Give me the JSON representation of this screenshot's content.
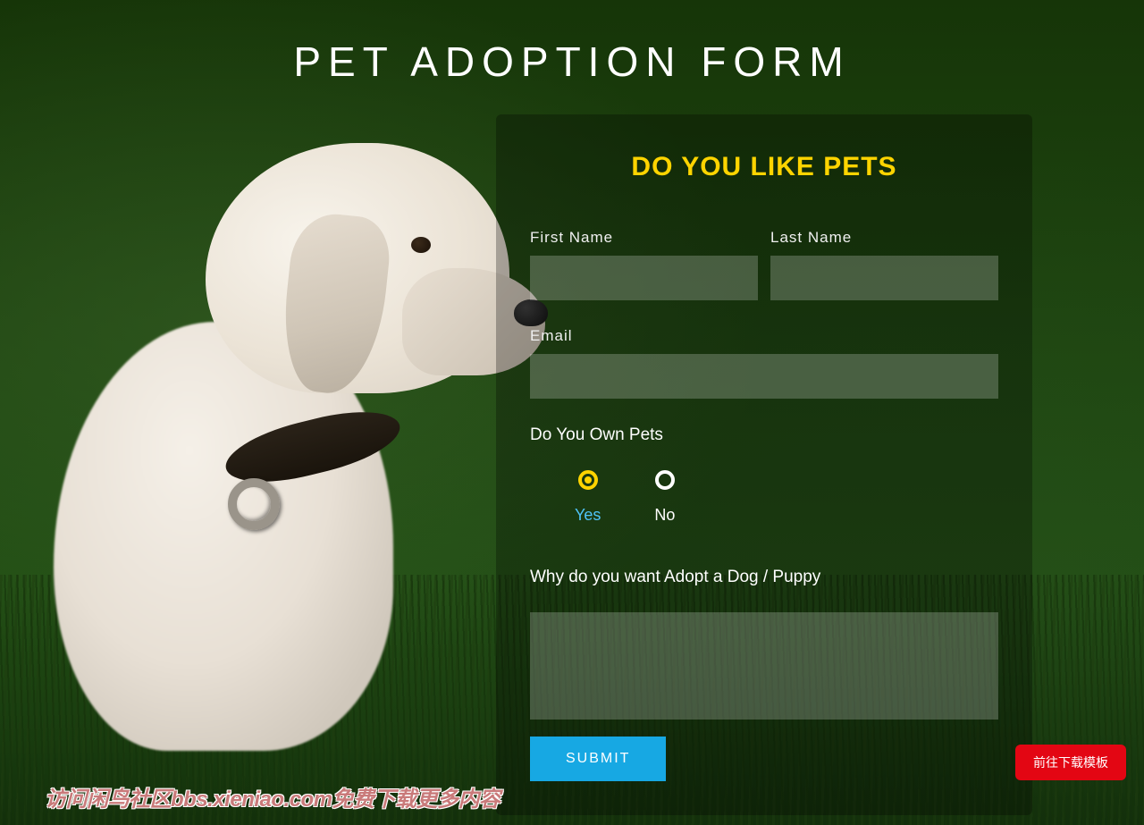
{
  "page": {
    "title": "PET ADOPTION FORM"
  },
  "form": {
    "heading": "DO YOU LIKE PETS",
    "first_name": {
      "label": "First Name",
      "value": ""
    },
    "last_name": {
      "label": "Last Name",
      "value": ""
    },
    "email": {
      "label": "Email",
      "value": ""
    },
    "own_pets": {
      "question": "Do You Own Pets",
      "options": {
        "yes": "Yes",
        "no": "No"
      },
      "selected": "yes"
    },
    "why_adopt": {
      "question": "Why do you want Adopt a Dog / Puppy",
      "value": ""
    },
    "submit_label": "SUBMIT"
  },
  "download_button": "前往下载模板",
  "watermark": "访问闲鸟社区bbs.xieniao.com免费下载更多内容"
}
